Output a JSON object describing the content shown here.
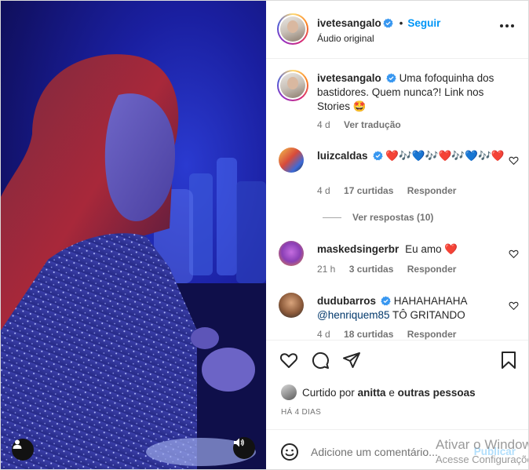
{
  "header": {
    "username": "ivetesangalo",
    "follow_label": "Seguir",
    "separator": "•",
    "audio_label": "Áudio original"
  },
  "caption": {
    "username": "ivetesangalo",
    "text": "Uma fofoquinha dos bastidores. Quem nunca?! Link nos Stories 🤩",
    "time": "4 d",
    "translate_label": "Ver tradução"
  },
  "comments": [
    {
      "username": "luizcaldas",
      "text": "❤️🎶💙🎶❤️🎶💙🎶❤️",
      "time": "4 d",
      "likes": "17 curtidas",
      "reply_label": "Responder",
      "view_replies": "Ver respostas (10)"
    },
    {
      "username": "maskedsingerbr",
      "text": "Eu amo ❤️",
      "time": "21 h",
      "likes": "3 curtidas",
      "reply_label": "Responder"
    },
    {
      "username": "dudubarros",
      "text": "HAHAHAHAHA",
      "mention": "@henriquem85",
      "text2": "TÔ GRITANDO",
      "time": "4 d",
      "likes": "18 curtidas",
      "reply_label": "Responder"
    }
  ],
  "likes_line": {
    "prefix": "Curtido por",
    "user": "anitta",
    "connector": "e",
    "others": "outras pessoas"
  },
  "post_date": "HÁ 4 DIAS",
  "composer": {
    "placeholder": "Adicione um comentário...",
    "post_label": "Publicar"
  },
  "watermark": {
    "line1": "Ativar o Windows",
    "line2": "Acesse Configurações para ativar o Windows."
  },
  "colors": {
    "accent": "#0095f6",
    "heart": "#ed1c24",
    "verified": "#3897f0"
  },
  "icons": [
    "user-icon",
    "speaker-icon",
    "heart-icon",
    "comment-icon",
    "share-icon",
    "bookmark-icon",
    "emoji-icon",
    "more-icon",
    "verified-icon"
  ]
}
